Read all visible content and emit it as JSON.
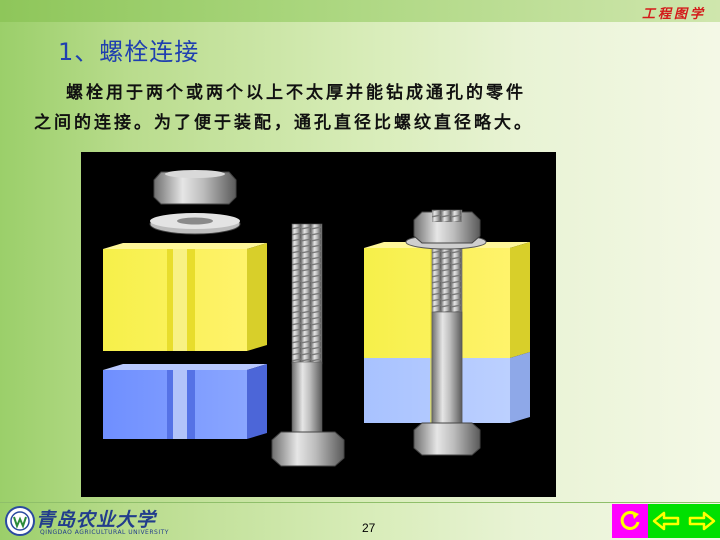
{
  "header": {
    "course_title": "工程图学"
  },
  "section": {
    "title": "1、螺栓连接"
  },
  "body": {
    "line1": "螺栓用于两个或两个以上不太厚并能钻成通孔的零件",
    "line2": "之间的连接。为了便于装配，通孔直径比螺纹直径略大。"
  },
  "footer": {
    "school_name": "青岛农业大学",
    "school_english": "QINGDAO AGRICULTURAL UNIVERSITY",
    "page_number": "27"
  },
  "nav": {
    "icons": [
      "repeat-icon",
      "arrow-left-icon",
      "arrow-right-icon"
    ]
  },
  "colors": {
    "title_blue": "#1f3fb0",
    "course_red": "#d41a1a",
    "nav_magenta": "#ff00ff",
    "nav_green": "#00e000"
  }
}
